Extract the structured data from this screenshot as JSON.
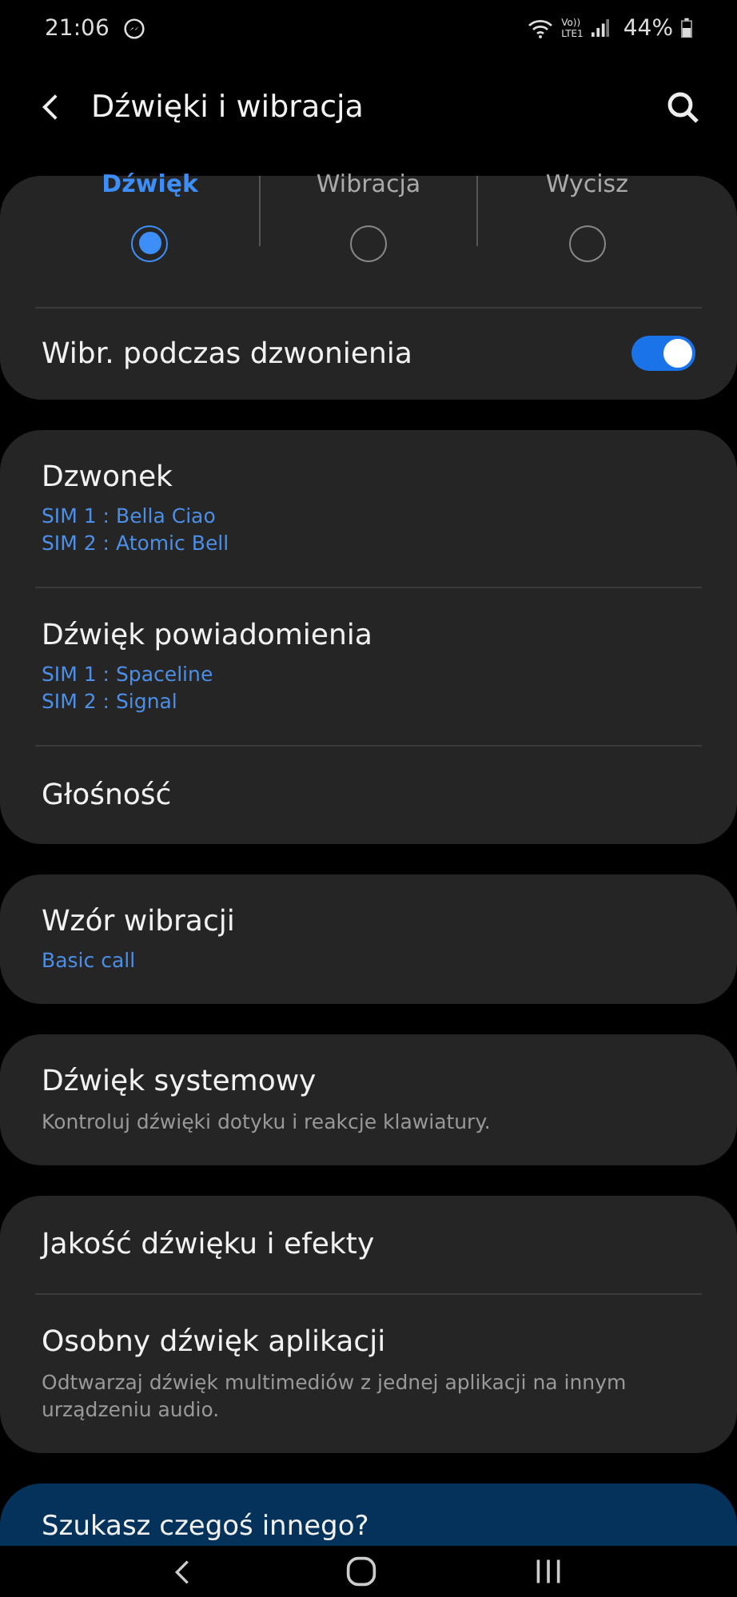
{
  "status_bar": {
    "time": "21:06",
    "volte": "Vo))",
    "network": "LTE1",
    "battery": "44%"
  },
  "header": {
    "title": "Dźwięki i wibracja"
  },
  "sound_modes": [
    {
      "label": "Dźwięk",
      "selected": true
    },
    {
      "label": "Wibracja",
      "selected": false
    },
    {
      "label": "Wycisz",
      "selected": false
    }
  ],
  "vibrate_while_ringing": {
    "label": "Wibr. podczas dzwonienia",
    "on": true
  },
  "groups": [
    {
      "items": [
        {
          "title": "Dzwonek",
          "values": [
            "SIM 1 : Bella Ciao",
            "SIM 2 : Atomic Bell"
          ]
        },
        {
          "title": "Dźwięk powiadomienia",
          "values": [
            "SIM 1 : Spaceline",
            "SIM 2 : Signal"
          ]
        },
        {
          "title": "Głośność"
        }
      ]
    },
    {
      "items": [
        {
          "title": "Wzór wibracji",
          "values": [
            "Basic call"
          ]
        }
      ]
    },
    {
      "items": [
        {
          "title": "Dźwięk systemowy",
          "description": "Kontroluj dźwięki dotyku i reakcje klawiatury."
        }
      ]
    },
    {
      "items": [
        {
          "title": "Jakość dźwięku i efekty"
        },
        {
          "title": "Osobny dźwięk aplikacji",
          "description": "Odtwarzaj dźwięk multimediów z jednej aplikacji na innym urządzeniu audio."
        }
      ]
    }
  ],
  "suggestion": {
    "title": "Szukasz czegoś innego?"
  }
}
